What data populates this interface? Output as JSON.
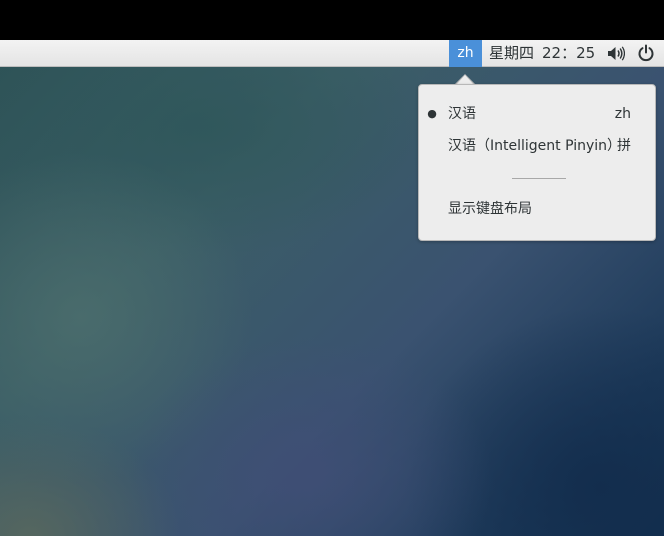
{
  "top_bar": {
    "input_indicator": "zh",
    "clock": {
      "weekday": "星期四",
      "time": "22：25"
    },
    "icons": [
      "volume-icon",
      "power-icon"
    ]
  },
  "input_menu": {
    "items": [
      {
        "label": "汉语",
        "shortcut": "zh",
        "selected": true,
        "bullet": "●"
      },
      {
        "label": "汉语（Intelligent Pinyin）",
        "shortcut": "拼",
        "selected": false,
        "bullet": ""
      }
    ],
    "show_layout_label": "显示键盘布局"
  },
  "colors": {
    "accent": "#4a90d9",
    "topbar": "#eeeeee",
    "menu_bg": "#ededed",
    "text": "#2e3436"
  }
}
